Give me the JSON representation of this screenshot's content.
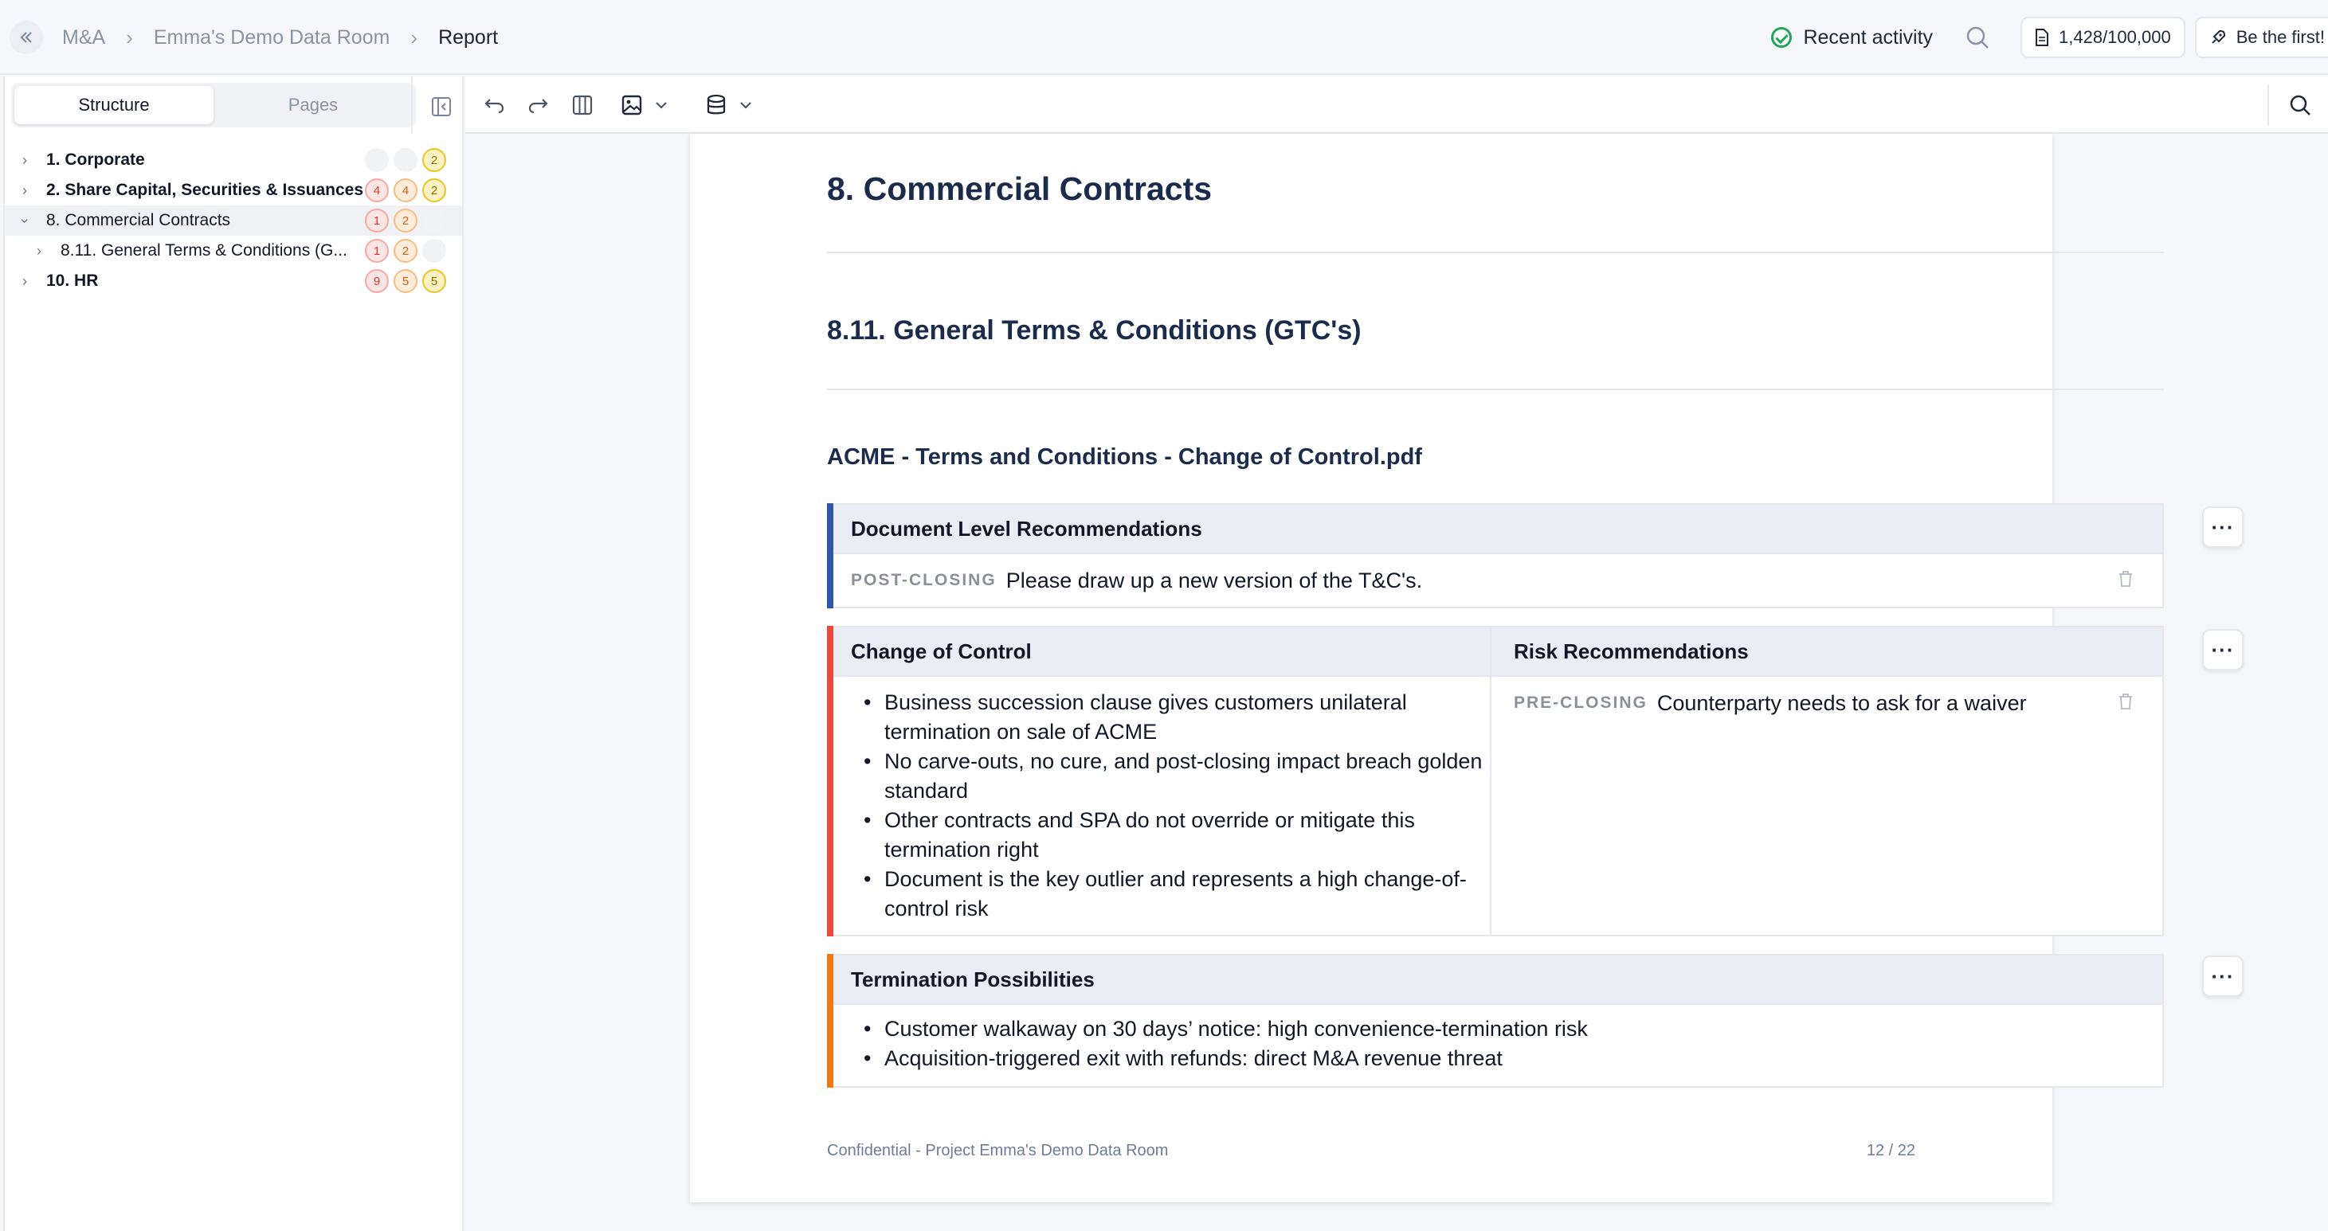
{
  "breadcrumb": {
    "items": [
      "M&A",
      "Emma's Demo Data Room",
      "Report"
    ]
  },
  "topbar": {
    "activity_label": "Recent activity",
    "usage": "1,428/100,000",
    "first_label": "Be the first!"
  },
  "sidebar": {
    "tabs": [
      "Structure",
      "Pages"
    ],
    "tree": [
      {
        "label": "1. Corporate",
        "badges": [
          {
            "type": "empty",
            "value": ""
          },
          {
            "type": "empty",
            "value": ""
          },
          {
            "type": "yellow",
            "value": "2"
          }
        ]
      },
      {
        "label": "2. Share Capital, Securities & Issuances",
        "badges": [
          {
            "type": "red",
            "value": "4"
          },
          {
            "type": "orange",
            "value": "4"
          },
          {
            "type": "yellow",
            "value": "2"
          }
        ]
      },
      {
        "label": "8. Commercial Contracts",
        "badges": [
          {
            "type": "red",
            "value": "1"
          },
          {
            "type": "orange",
            "value": "2"
          },
          {
            "type": "empty",
            "value": ""
          }
        ]
      },
      {
        "label": "8.11. General Terms & Conditions (G...",
        "badges": [
          {
            "type": "red",
            "value": "1"
          },
          {
            "type": "orange",
            "value": "2"
          },
          {
            "type": "empty",
            "value": ""
          }
        ]
      },
      {
        "label": "10. HR",
        "badges": [
          {
            "type": "red",
            "value": "9"
          },
          {
            "type": "orange",
            "value": "5"
          },
          {
            "type": "yellow",
            "value": "5"
          }
        ]
      }
    ]
  },
  "report": {
    "h1": "8. Commercial Contracts",
    "h2": "8.11. General Terms & Conditions (GTC's)",
    "h3": "ACME - Terms and Conditions - Change of Control.pdf",
    "doc_rec": {
      "title": "Document Level Recommendations",
      "tag": "POST-CLOSING",
      "text": "Please draw up a new version of the T&C's."
    },
    "change_of_control": {
      "title": "Change of Control",
      "right_title": "Risk Recommendations",
      "bullets": [
        "Business succession clause gives customers unilateral termination on sale of ACME",
        "No carve-outs, no cure, and post-closing impact breach golden standard",
        "Other contracts and SPA do not override or mitigate this termination right",
        "Document is the key outlier and represents a high change-of-control risk"
      ],
      "tag": "PRE-CLOSING",
      "rec_text": "Counterparty needs to ask for a waiver"
    },
    "termination": {
      "title": "Termination Possibilities",
      "bullets": [
        "Customer walkaway on 30 days’ notice: high convenience-termination risk",
        "Acquisition-triggered exit with refunds: direct M&A revenue threat"
      ]
    },
    "more_label": "···",
    "footer_left": "Confidential - Project Emma's Demo Data Room",
    "footer_right": "12 / 22"
  },
  "colors": {
    "blue_bar": "#2f56a8",
    "red_bar": "#ea4a3c",
    "orange_bar": "#f07a1a",
    "heading": "#1a2b4c"
  }
}
